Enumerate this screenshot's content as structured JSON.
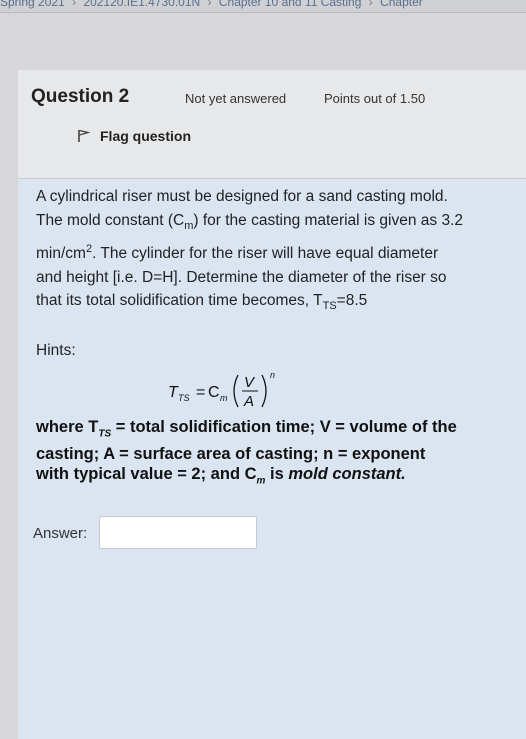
{
  "breadcrumb": {
    "items": [
      "Spring 2021",
      "202120.IE1.4730.01N",
      "Chapter 10 and 11 Casting",
      "Chapter"
    ]
  },
  "question": {
    "title": "Question 2",
    "status": "Not yet answered",
    "points": "Points out of 1.50",
    "flag_label": "Flag question"
  },
  "body": {
    "line1": "A cylindrical riser must be designed for a sand casting mold.",
    "line2a": "The mold constant (C",
    "line2_sub": "m",
    "line2b": ") for the casting material is given as 3.2",
    "line3a": "min/cm",
    "line3_sup": "2",
    "line3b": ". The cylinder for the riser will have equal diameter",
    "line4": "and height [i.e. D=H]. Determine the diameter of the riser so",
    "line5a": "that its total solidification time becomes, T",
    "line5_sub": "TS",
    "line5b": "=8.5",
    "hints": "Hints:"
  },
  "formula": {
    "lhs": "T",
    "lhs_sub": "TS",
    "eq": "=",
    "c": "C",
    "c_sub": "m",
    "num": "V",
    "den": "A",
    "exp": "n"
  },
  "where": {
    "p1": "where T",
    "p1_sub": "TS",
    "p2": " = total solidification time; V = volume of the",
    "p3": "casting; A = surface area of casting; n = exponent",
    "p4": "with typical value = 2; and C",
    "p4_sub": "m",
    "p5": " is ",
    "p6": "mold constant."
  },
  "answer": {
    "label": "Answer:",
    "value": ""
  },
  "icons": {
    "flag": "flag-icon"
  }
}
